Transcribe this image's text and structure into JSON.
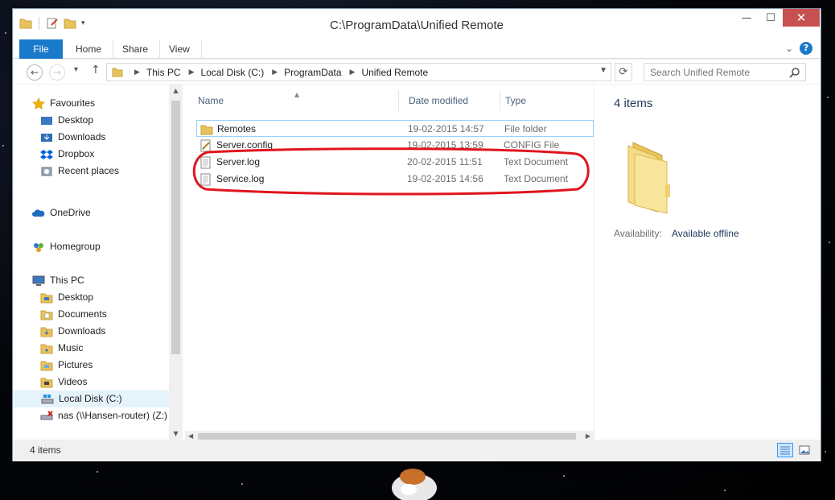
{
  "window": {
    "title": "C:\\ProgramData\\Unified Remote",
    "controls": {
      "minimize": "—",
      "maximize": "☐",
      "close": "✕"
    }
  },
  "ribbon": {
    "tabs": [
      "File",
      "Home",
      "Share",
      "View"
    ],
    "expand": "⌄",
    "help": "?"
  },
  "navigation": {
    "back": "←",
    "forward": "→",
    "recent": "▾",
    "up": "↑",
    "breadcrumb": [
      "This PC",
      "Local Disk (C:)",
      "ProgramData",
      "Unified Remote"
    ],
    "refresh": "⟳",
    "search_placeholder": "Search Unified Remote"
  },
  "nav_pane": {
    "favourites": {
      "label": "Favourites",
      "items": [
        "Desktop",
        "Downloads",
        "Dropbox",
        "Recent places"
      ]
    },
    "onedrive": "OneDrive",
    "homegroup": "Homegroup",
    "this_pc": {
      "label": "This PC",
      "items": [
        "Desktop",
        "Documents",
        "Downloads",
        "Music",
        "Pictures",
        "Videos",
        "Local Disk (C:)",
        "nas (\\\\Hansen-router) (Z:)"
      ]
    }
  },
  "file_list": {
    "columns": {
      "name": "Name",
      "date": "Date modified",
      "type": "Type"
    },
    "rows": [
      {
        "name": "Remotes",
        "date": "19-02-2015 14:57",
        "type": "File folder",
        "icon": "folder-icon"
      },
      {
        "name": "Server.config",
        "date": "19-02-2015 13:59",
        "type": "CONFIG File",
        "icon": "config-file-icon"
      },
      {
        "name": "Server.log",
        "date": "20-02-2015 11:51",
        "type": "Text Document",
        "icon": "text-file-icon"
      },
      {
        "name": "Service.log",
        "date": "19-02-2015 14:56",
        "type": "Text Document",
        "icon": "text-file-icon"
      }
    ],
    "annotation_color": "#e0141e"
  },
  "details_pane": {
    "count": "4 items",
    "availability_label": "Availability:",
    "availability_value": "Available offline"
  },
  "status_bar": {
    "count": "4 items"
  },
  "colors": {
    "file_tab": "#1979ca",
    "close_button": "#c75050",
    "selection": "#e5f3fb"
  }
}
